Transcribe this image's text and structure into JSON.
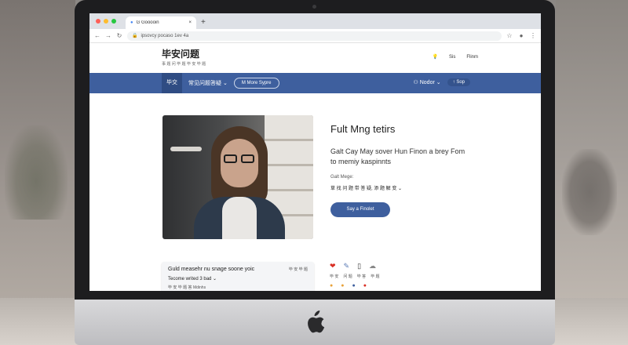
{
  "browser": {
    "tab_title": "G Gooooin",
    "new_tab": "+",
    "url": "ipsovcy pocaso 1ev 4a"
  },
  "site": {
    "logo": "毕安问题",
    "tagline": "事 题 问 毕 题 毕 安 毕 题",
    "header_links": [
      "Sis",
      "Flinm"
    ]
  },
  "nav": {
    "home": "毕交",
    "menu": "常见问题答疑",
    "pill": "M More Sypre",
    "right": [
      "Nodor",
      "Sop"
    ]
  },
  "hero": {
    "title": "Fult Mng tetirs",
    "desc_line1": "Galt Cay May sover Hun Finon a brey Fom",
    "desc_line2": "to memiy kaspinnts",
    "label": "Galt Mege:",
    "select": "草 找 问 题 带 答 疑, 添 题 解 变",
    "button": "Say a Finolet"
  },
  "card": {
    "title": "Guld measehr nu snage soone yoic",
    "tag": "毕 安 毕 题",
    "line2": "Tecome writed 3 bad",
    "line3": "毕 安 毕 题 答 Mdinhs"
  },
  "share": {
    "labels": [
      "毕 安",
      "问 题",
      "毕 答",
      "毕 题"
    ]
  },
  "colors": {
    "brand": "#3e5f9e",
    "brand_dark": "#2f4c83"
  }
}
